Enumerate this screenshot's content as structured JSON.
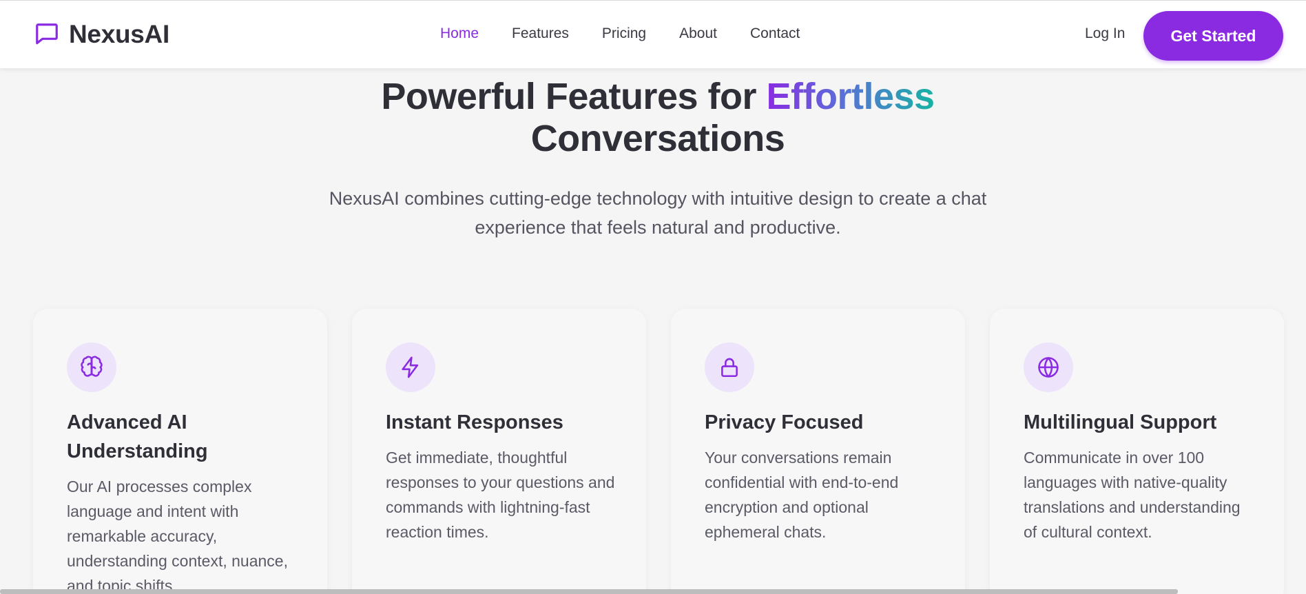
{
  "brand": {
    "name": "NexusAI",
    "icon": "chat-bubble-icon",
    "accent_color": "#8a2be2"
  },
  "nav": {
    "links": [
      {
        "label": "Home",
        "active": true
      },
      {
        "label": "Features",
        "active": false
      },
      {
        "label": "Pricing",
        "active": false
      },
      {
        "label": "About",
        "active": false
      },
      {
        "label": "Contact",
        "active": false
      }
    ],
    "login_label": "Log In",
    "cta_label": "Get Started"
  },
  "hero": {
    "title_prefix": "Powerful Features for ",
    "title_highlight": "Effortless",
    "title_suffix": "Conversations",
    "subtitle_line1": "NexusAI combines cutting-edge technology with intuitive design to create a chat",
    "subtitle_line2": "experience that feels natural and productive.",
    "gradient_colors": [
      "#8a2be2",
      "#5a6fd8",
      "#17b3a2"
    ]
  },
  "features": [
    {
      "icon": "brain-icon",
      "title": "Advanced AI Understanding",
      "description": "Our AI processes complex language and intent with remarkable accuracy, understanding context, nuance, and topic shifts."
    },
    {
      "icon": "lightning-bolt-icon",
      "title": "Instant Responses",
      "description": "Get immediate, thoughtful responses to your questions and commands with lightning-fast reaction times."
    },
    {
      "icon": "lock-icon",
      "title": "Privacy Focused",
      "description": "Your conversations remain confidential with end-to-end encryption and optional ephemeral chats."
    },
    {
      "icon": "globe-icon",
      "title": "Multilingual Support",
      "description": "Communicate in over 100 languages with native-quality translations and understanding of cultural context."
    }
  ]
}
